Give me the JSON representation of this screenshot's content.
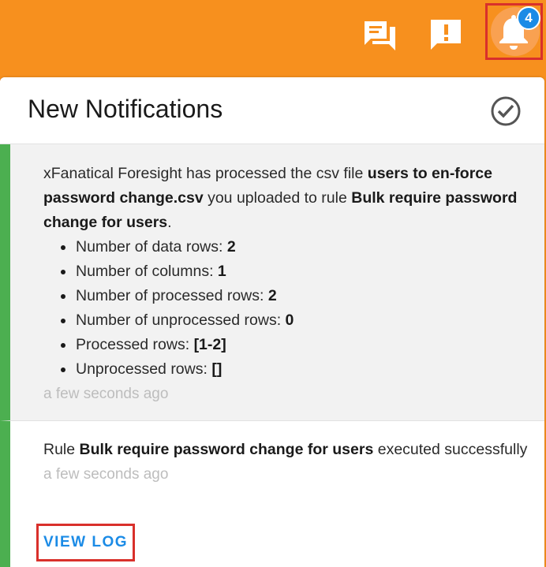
{
  "topbar": {
    "icons": [
      "chat-icon",
      "feedback-icon",
      "bell-icon"
    ],
    "notification_count": "4",
    "colors": {
      "background": "#f7901e",
      "badge": "#1b8be6",
      "highlight": "#d9302b"
    }
  },
  "panel": {
    "title": "New Notifications",
    "mark_all_read_icon": "check-circle-icon"
  },
  "notifications": [
    {
      "text_prefix": "xFanatical Foresight has processed the csv file ",
      "file": "users to en-force password change.csv",
      "text_middle": " you uploaded to rule ",
      "rule": "Bulk require password change for users",
      "text_suffix": ".",
      "stats": [
        {
          "label": "Number of data rows: ",
          "value": "2"
        },
        {
          "label": "Number of columns: ",
          "value": "1"
        },
        {
          "label": "Number of processed rows: ",
          "value": "2"
        },
        {
          "label": "Number of unprocessed rows: ",
          "value": "0"
        },
        {
          "label": "Processed rows: ",
          "value": "[1-2]"
        },
        {
          "label": "Unprocessed rows: ",
          "value": "[]"
        }
      ],
      "time": "a few seconds ago"
    },
    {
      "text_prefix": "Rule ",
      "rule": "Bulk require password change for users",
      "text_suffix": " executed successfully",
      "time": "a few seconds ago",
      "action_label": "VIEW LOG"
    }
  ]
}
